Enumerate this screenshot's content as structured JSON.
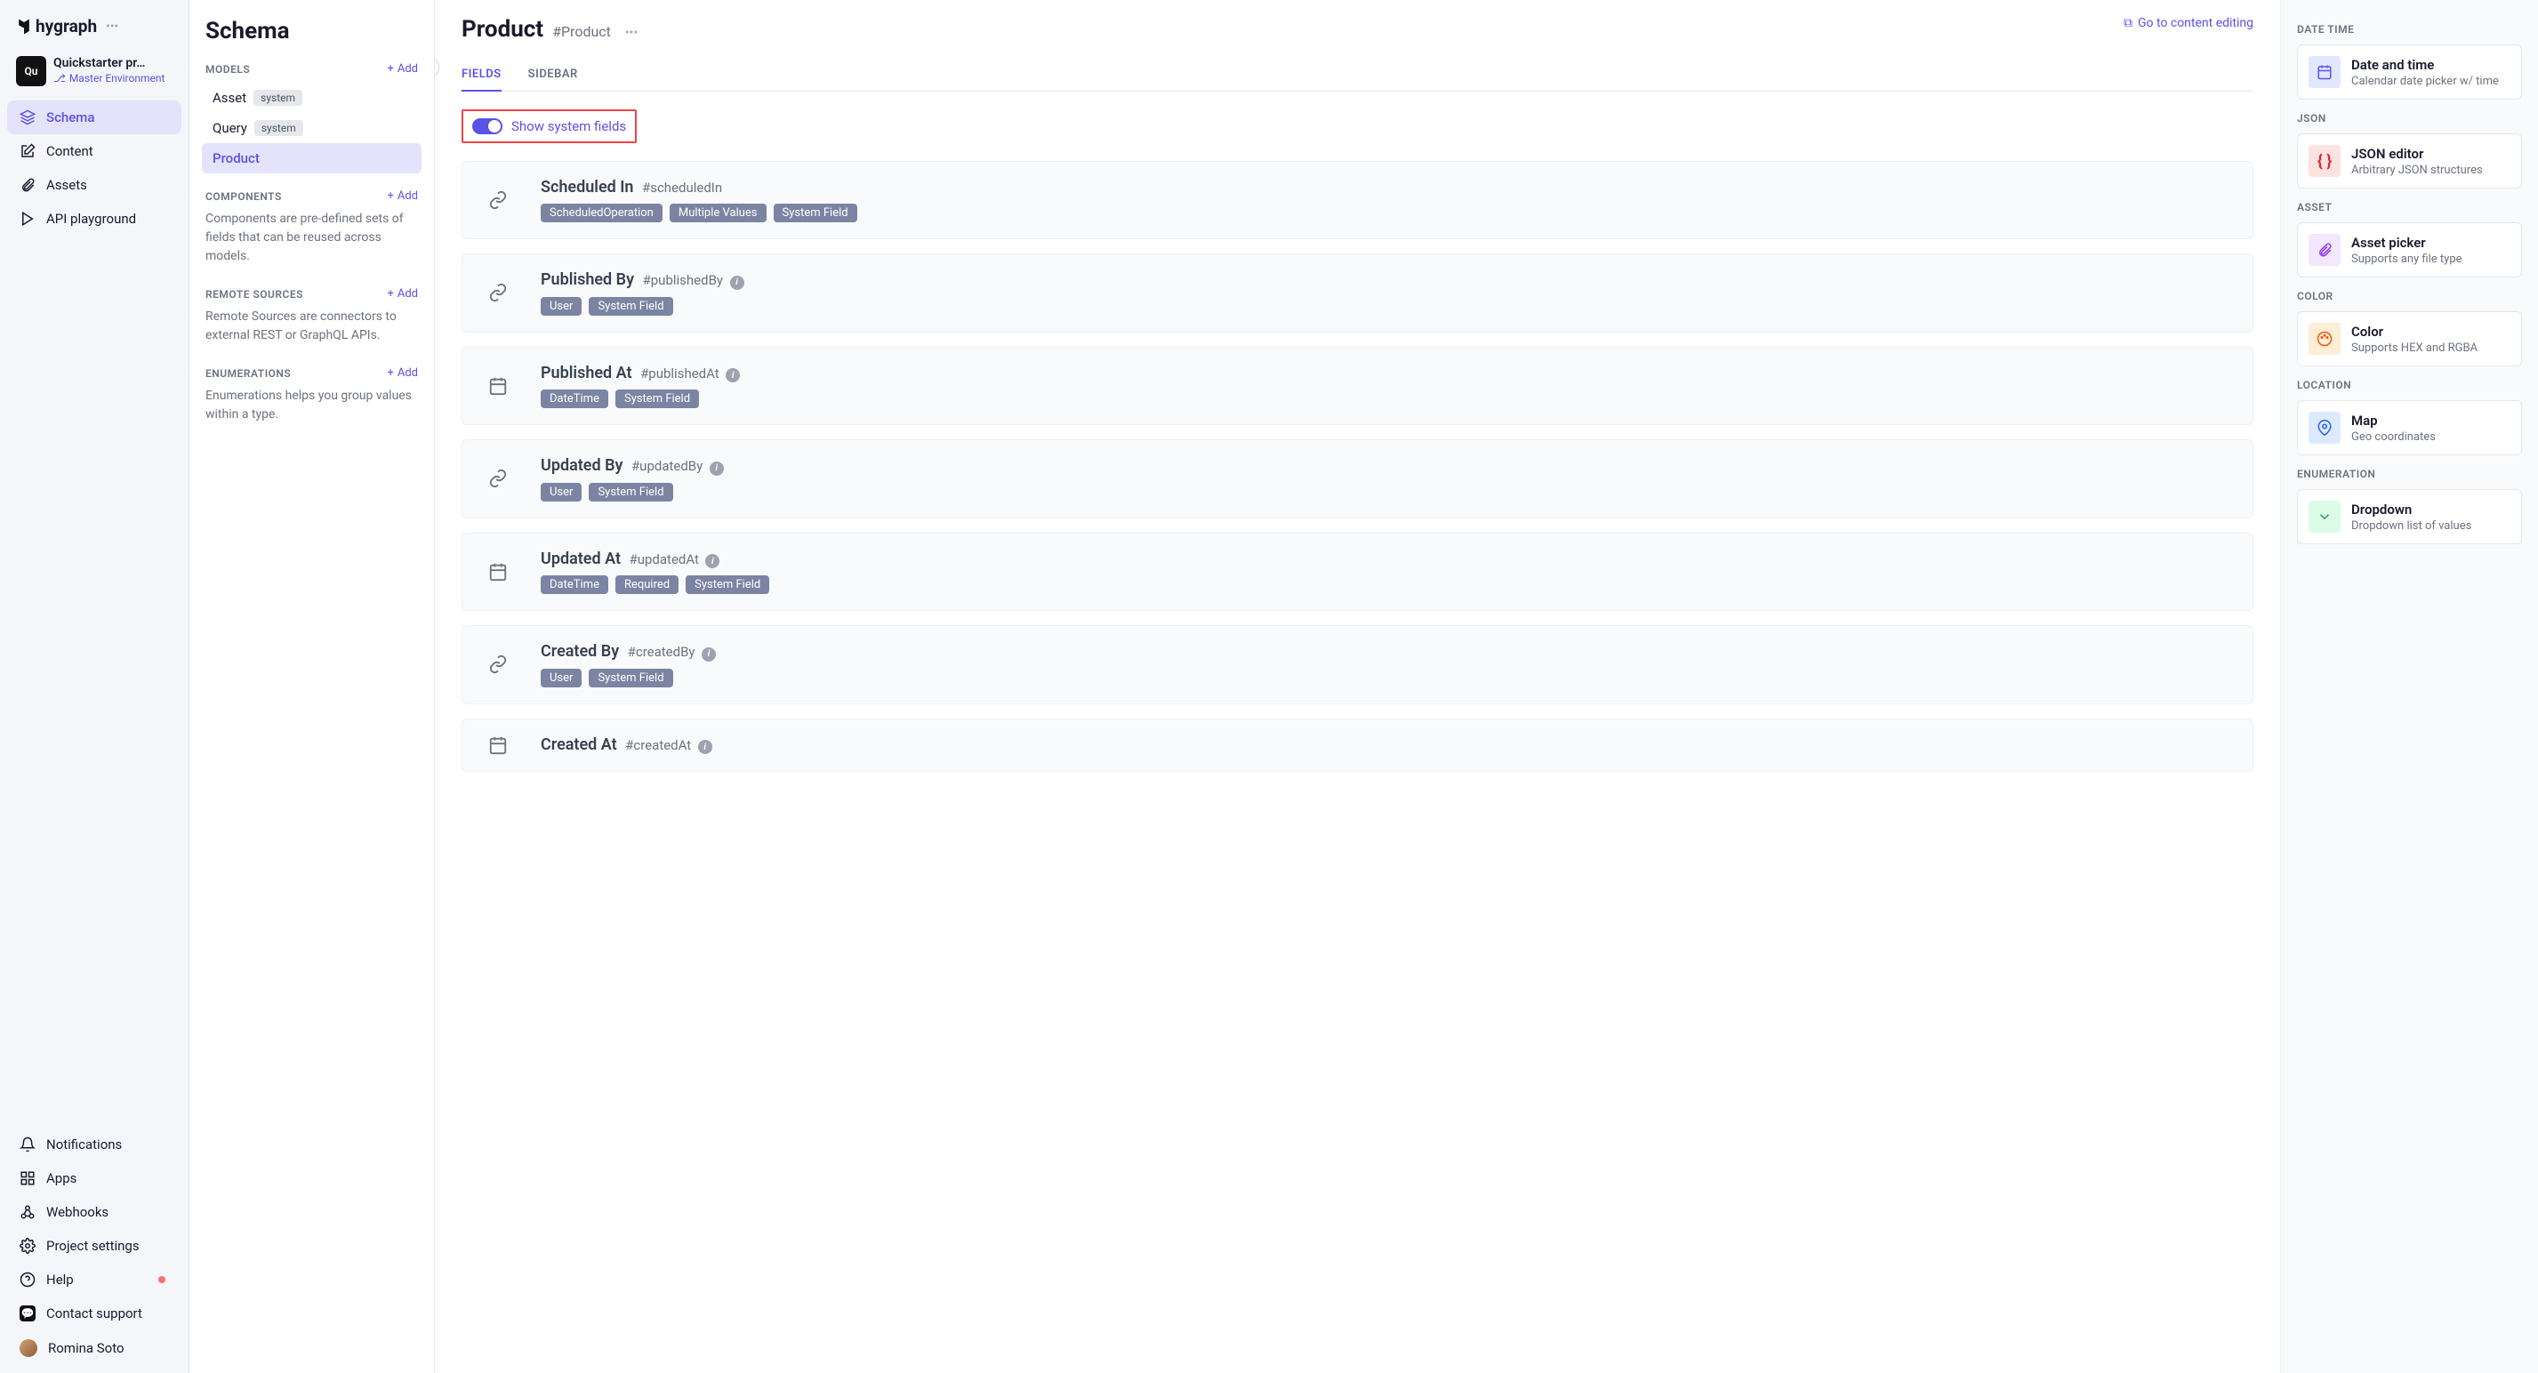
{
  "logo_text": "hygraph",
  "project": {
    "badge": "Qu",
    "name": "Quickstarter pr…",
    "env": "Master Environment"
  },
  "nav": {
    "primary": [
      {
        "key": "schema",
        "label": "Schema"
      },
      {
        "key": "content",
        "label": "Content"
      },
      {
        "key": "assets",
        "label": "Assets"
      },
      {
        "key": "api",
        "label": "API playground"
      }
    ],
    "secondary": [
      {
        "key": "notifications",
        "label": "Notifications"
      },
      {
        "key": "apps",
        "label": "Apps"
      },
      {
        "key": "webhooks",
        "label": "Webhooks"
      },
      {
        "key": "settings",
        "label": "Project settings"
      },
      {
        "key": "help",
        "label": "Help"
      },
      {
        "key": "support",
        "label": "Contact support"
      },
      {
        "key": "user",
        "label": "Romina Soto"
      }
    ]
  },
  "schema_panel": {
    "title": "Schema",
    "models_label": "MODELS",
    "add_label": "Add",
    "models": [
      {
        "name": "Asset",
        "system": true
      },
      {
        "name": "Query",
        "system": true
      },
      {
        "name": "Product",
        "system": false
      }
    ],
    "system_pill": "system",
    "components_label": "COMPONENTS",
    "components_desc": "Components are pre-defined sets of fields that can be reused across models.",
    "remote_label": "REMOTE SOURCES",
    "remote_desc": "Remote Sources are connectors to external REST or GraphQL APIs.",
    "enum_label": "ENUMERATIONS",
    "enum_desc": "Enumerations helps you group values within a type."
  },
  "content": {
    "title": "Product",
    "api_id": "#Product",
    "go_link": "Go to content editing",
    "tabs": {
      "fields": "FIELDS",
      "sidebar": "SIDEBAR"
    },
    "toggle_label": "Show system fields",
    "fields": [
      {
        "icon": "link",
        "title": "Scheduled In",
        "api": "#scheduledIn",
        "info": false,
        "chips": [
          "ScheduledOperation",
          "Multiple Values",
          "System Field"
        ]
      },
      {
        "icon": "link",
        "title": "Published By",
        "api": "#publishedBy",
        "info": true,
        "chips": [
          "User",
          "System Field"
        ]
      },
      {
        "icon": "calendar",
        "title": "Published At",
        "api": "#publishedAt",
        "info": true,
        "chips": [
          "DateTime",
          "System Field"
        ]
      },
      {
        "icon": "link",
        "title": "Updated By",
        "api": "#updatedBy",
        "info": true,
        "chips": [
          "User",
          "System Field"
        ]
      },
      {
        "icon": "calendar",
        "title": "Updated At",
        "api": "#updatedAt",
        "info": true,
        "chips": [
          "DateTime",
          "Required",
          "System Field"
        ]
      },
      {
        "icon": "link",
        "title": "Created By",
        "api": "#createdBy",
        "info": true,
        "chips": [
          "User",
          "System Field"
        ]
      },
      {
        "icon": "calendar",
        "title": "Created At",
        "api": "#createdAt",
        "info": true,
        "chips": []
      }
    ]
  },
  "right_panel": {
    "groups": [
      {
        "label": "DATE TIME",
        "items": [
          {
            "icon": "calendar",
            "bg": "#e0e7ff",
            "fg": "#5b52e6",
            "title": "Date and time",
            "desc": "Calendar date picker w/ time"
          }
        ]
      },
      {
        "label": "JSON",
        "items": [
          {
            "icon": "braces",
            "bg": "#fee2e2",
            "fg": "#dc2626",
            "title": "JSON editor",
            "desc": "Arbitrary JSON structures"
          }
        ]
      },
      {
        "label": "ASSET",
        "items": [
          {
            "icon": "clip",
            "bg": "#f3e8ff",
            "fg": "#9333ea",
            "title": "Asset picker",
            "desc": "Supports any file type"
          }
        ]
      },
      {
        "label": "COLOR",
        "items": [
          {
            "icon": "palette",
            "bg": "#ffedd5",
            "fg": "#ea580c",
            "title": "Color",
            "desc": "Supports HEX and RGBA"
          }
        ]
      },
      {
        "label": "LOCATION",
        "items": [
          {
            "icon": "pin",
            "bg": "#dbeafe",
            "fg": "#2563eb",
            "title": "Map",
            "desc": "Geo coordinates"
          }
        ]
      },
      {
        "label": "ENUMERATION",
        "items": [
          {
            "icon": "dropdown",
            "bg": "#dcfce7",
            "fg": "#16a34a",
            "title": "Dropdown",
            "desc": "Dropdown list of values"
          }
        ]
      }
    ]
  }
}
